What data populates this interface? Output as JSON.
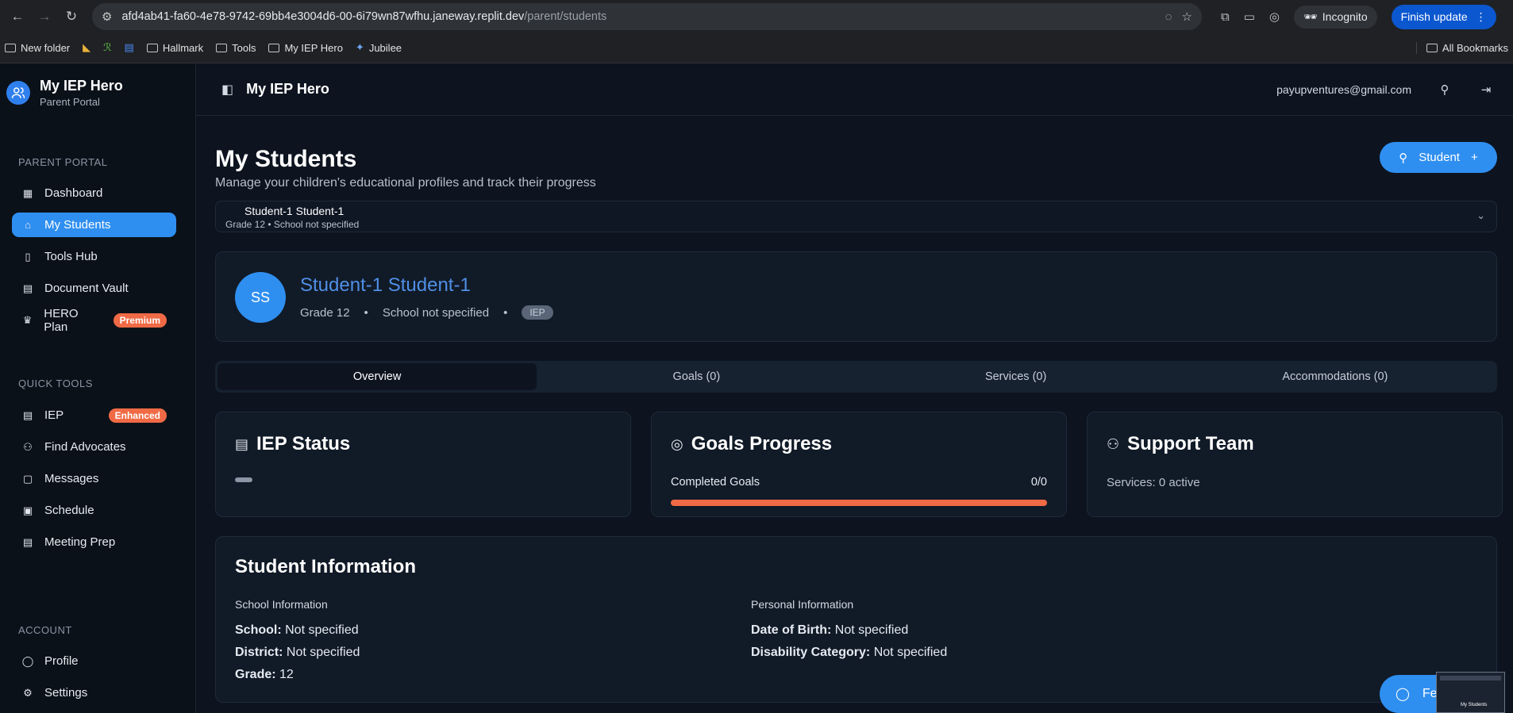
{
  "browser": {
    "url_host": "afd4ab41-fa60-4e78-9742-69bb4e3004d6-00-6i79wn87wfhu.janeway.replit.dev",
    "url_path": "/parent/students",
    "incognito_label": "Incognito",
    "finish_update_label": "Finish update",
    "bookmarks": [
      "New folder",
      "Hallmark",
      "Tools",
      "My IEP Hero",
      "Jubilee"
    ],
    "all_bookmarks_label": "All Bookmarks"
  },
  "sidebar": {
    "brand_title": "My IEP Hero",
    "brand_subtitle": "Parent Portal",
    "section_portal": "PARENT PORTAL",
    "portal_items": [
      {
        "label": "Dashboard",
        "icon": "grid-icon"
      },
      {
        "label": "My Students",
        "icon": "graduation-cap-icon",
        "active": true
      },
      {
        "label": "Tools Hub",
        "icon": "book-icon"
      },
      {
        "label": "Document Vault",
        "icon": "document-icon"
      },
      {
        "label": "HERO Plan",
        "icon": "crown-icon",
        "badge": "Premium"
      }
    ],
    "section_tools": "QUICK TOOLS",
    "tool_items": [
      {
        "label": "IEP",
        "icon": "document-icon",
        "badge": "Enhanced"
      },
      {
        "label": "Find Advocates",
        "icon": "users-icon"
      },
      {
        "label": "Messages",
        "icon": "chat-icon"
      },
      {
        "label": "Schedule",
        "icon": "calendar-icon"
      },
      {
        "label": "Meeting Prep",
        "icon": "document-icon"
      }
    ],
    "section_account": "ACCOUNT",
    "account_items": [
      {
        "label": "Profile",
        "icon": "user-icon"
      },
      {
        "label": "Settings",
        "icon": "gear-icon"
      }
    ]
  },
  "topbar": {
    "title": "My IEP Hero",
    "email": "payupventures@gmail.com"
  },
  "page": {
    "title": "My Students",
    "subtitle": "Manage your children's educational profiles and track their progress",
    "add_button_label": "Student"
  },
  "student_selector": {
    "name": "Student-1 Student-1",
    "meta": "Grade 12 • School not specified"
  },
  "profile": {
    "initials": "SS",
    "name": "Student-1 Student-1",
    "grade": "Grade 12",
    "school": "School not specified",
    "separator": "•",
    "tag": "IEP"
  },
  "tabs": [
    "Overview",
    "Goals (0)",
    "Services (0)",
    "Accommodations (0)"
  ],
  "cards": {
    "iep_status": {
      "title": "IEP Status"
    },
    "goals_progress": {
      "title": "Goals Progress",
      "label": "Completed Goals",
      "value": "0/0",
      "progress_fraction": 1.0
    },
    "support_team": {
      "title": "Support Team",
      "text": "Services: 0 active"
    }
  },
  "student_info": {
    "title": "Student Information",
    "school_section": "School Information",
    "school_rows": [
      {
        "key": "School:",
        "value": "Not specified"
      },
      {
        "key": "District:",
        "value": "Not specified"
      },
      {
        "key": "Grade:",
        "value": "12"
      }
    ],
    "personal_section": "Personal Information",
    "personal_rows": [
      {
        "key": "Date of Birth:",
        "value": "Not specified"
      },
      {
        "key": "Disability Category:",
        "value": "Not specified"
      }
    ]
  },
  "feedback_label": "Fe",
  "thumbnail_label": "My Students"
}
